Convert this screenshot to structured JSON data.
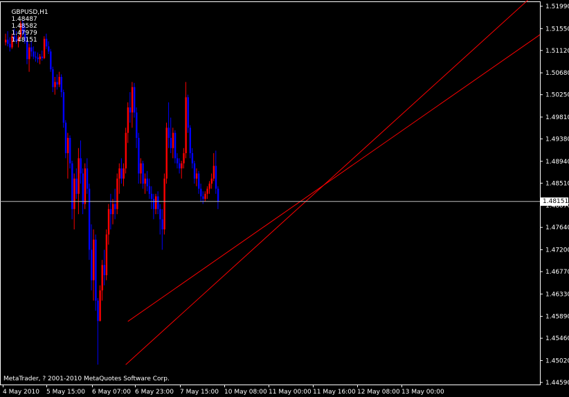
{
  "header": {
    "symbol": "GBPUSD,H1",
    "open": "1.48487",
    "high": "1.48582",
    "low": "1.47979",
    "close": "1.48151"
  },
  "copyright": "MetaTrader, ? 2001-2010 MetaQuotes Software Corp.",
  "current_price_label": "1.48151",
  "colors": {
    "background": "#000000",
    "bull": "#ff0000",
    "bear": "#0000ff",
    "text": "#ffffff",
    "axis": "#ffffff",
    "trendline": "#ff0000",
    "price_line": "#c0c0c0"
  },
  "chart_data": {
    "type": "candlestick",
    "y_ticks": [
      "1.51990",
      "1.51550",
      "1.51120",
      "1.50680",
      "1.50250",
      "1.49810",
      "1.49380",
      "1.48940",
      "1.48510",
      "1.48070",
      "1.47640",
      "1.47200",
      "1.46770",
      "1.46330",
      "1.45890",
      "1.45460",
      "1.45020",
      "1.44590"
    ],
    "y_tick_values": [
      1.5199,
      1.5155,
      1.5112,
      1.5068,
      1.5025,
      1.4981,
      1.4938,
      1.4894,
      1.4851,
      1.4807,
      1.4764,
      1.472,
      1.4677,
      1.4633,
      1.4589,
      1.4546,
      1.4502,
      1.4459
    ],
    "x_ticks": [
      "4 May 2010",
      "5 May 15:00",
      "6 May 07:00",
      "6 May 23:00",
      "7 May 15:00",
      "10 May 08:00",
      "11 May 00:00",
      "11 May 16:00",
      "12 May 08:00",
      "13 May 00:00"
    ],
    "current_price": 1.48151,
    "trendlines": [
      {
        "from": [
          57,
          1.4579
        ],
        "to": [
          200,
          1.4999
        ]
      },
      {
        "from": [
          56,
          1.4494
        ],
        "to": [
          200,
          1.5045
        ]
      }
    ],
    "candles": [
      [
        1.5128,
        1.5145,
        1.5122,
        1.5133
      ],
      [
        1.5133,
        1.515,
        1.512,
        1.5125
      ],
      [
        1.5125,
        1.5138,
        1.511,
        1.5118
      ],
      [
        1.5118,
        1.5145,
        1.5115,
        1.514
      ],
      [
        1.514,
        1.5155,
        1.513,
        1.5135
      ],
      [
        1.5135,
        1.515,
        1.5125,
        1.513
      ],
      [
        1.513,
        1.5142,
        1.5118,
        1.5138
      ],
      [
        1.5138,
        1.517,
        1.5135,
        1.5165
      ],
      [
        1.5165,
        1.5172,
        1.514,
        1.5145
      ],
      [
        1.5145,
        1.516,
        1.5125,
        1.513
      ],
      [
        1.513,
        1.514,
        1.5085,
        1.5095
      ],
      [
        1.5095,
        1.5125,
        1.507,
        1.5118
      ],
      [
        1.5118,
        1.513,
        1.51,
        1.511
      ],
      [
        1.511,
        1.512,
        1.5095,
        1.51
      ],
      [
        1.51,
        1.511,
        1.509,
        1.5098
      ],
      [
        1.5098,
        1.5108,
        1.5088,
        1.5095
      ],
      [
        1.5095,
        1.5105,
        1.5085,
        1.51
      ],
      [
        1.51,
        1.5112,
        1.5092,
        1.5097
      ],
      [
        1.5097,
        1.514,
        1.5095,
        1.5135
      ],
      [
        1.5135,
        1.5145,
        1.5115,
        1.512
      ],
      [
        1.512,
        1.513,
        1.5105,
        1.511
      ],
      [
        1.511,
        1.5115,
        1.507,
        1.5075
      ],
      [
        1.5075,
        1.508,
        1.503,
        1.504
      ],
      [
        1.504,
        1.506,
        1.5025,
        1.505
      ],
      [
        1.505,
        1.5065,
        1.5035,
        1.5045
      ],
      [
        1.5045,
        1.507,
        1.504,
        1.506
      ],
      [
        1.506,
        1.5065,
        1.502,
        1.503
      ],
      [
        1.503,
        1.5035,
        1.496,
        1.497
      ],
      [
        1.497,
        1.4975,
        1.49,
        1.491
      ],
      [
        1.491,
        1.495,
        1.486,
        1.494
      ],
      [
        1.494,
        1.4945,
        1.488,
        1.489
      ],
      [
        1.489,
        1.4895,
        1.478,
        1.48
      ],
      [
        1.48,
        1.487,
        1.476,
        1.486
      ],
      [
        1.486,
        1.488,
        1.482,
        1.483
      ],
      [
        1.483,
        1.492,
        1.479,
        1.49
      ],
      [
        1.49,
        1.4935,
        1.485,
        1.487
      ],
      [
        1.487,
        1.488,
        1.479,
        1.481
      ],
      [
        1.481,
        1.489,
        1.48,
        1.488
      ],
      [
        1.488,
        1.49,
        1.483,
        1.484
      ],
      [
        1.484,
        1.485,
        1.47,
        1.472
      ],
      [
        1.472,
        1.477,
        1.464,
        1.466
      ],
      [
        1.466,
        1.476,
        1.462,
        1.474
      ],
      [
        1.474,
        1.475,
        1.46,
        1.462
      ],
      [
        1.462,
        1.4625,
        1.4494,
        1.458
      ],
      [
        1.458,
        1.465,
        1.4579,
        1.464
      ],
      [
        1.464,
        1.47,
        1.462,
        1.469
      ],
      [
        1.469,
        1.472,
        1.465,
        1.467
      ],
      [
        1.467,
        1.476,
        1.466,
        1.475
      ],
      [
        1.475,
        1.481,
        1.473,
        1.48
      ],
      [
        1.48,
        1.483,
        1.476,
        1.479
      ],
      [
        1.479,
        1.482,
        1.477,
        1.481
      ],
      [
        1.481,
        1.484,
        1.478,
        1.48
      ],
      [
        1.48,
        1.487,
        1.479,
        1.486
      ],
      [
        1.486,
        1.489,
        1.483,
        1.488
      ],
      [
        1.488,
        1.49,
        1.485,
        1.486
      ],
      [
        1.486,
        1.489,
        1.4845,
        1.488
      ],
      [
        1.488,
        1.496,
        1.487,
        1.495
      ],
      [
        1.495,
        1.501,
        1.493,
        1.5
      ],
      [
        1.5,
        1.503,
        1.497,
        1.499
      ],
      [
        1.499,
        1.505,
        1.496,
        1.504
      ],
      [
        1.504,
        1.5048,
        1.498,
        1.499
      ],
      [
        1.499,
        1.5,
        1.492,
        1.494
      ],
      [
        1.494,
        1.495,
        1.485,
        1.487
      ],
      [
        1.487,
        1.49,
        1.485,
        1.489
      ],
      [
        1.489,
        1.4895,
        1.484,
        1.485
      ],
      [
        1.485,
        1.487,
        1.483,
        1.486
      ],
      [
        1.486,
        1.4875,
        1.4835,
        1.4845
      ],
      [
        1.4845,
        1.486,
        1.482,
        1.483
      ],
      [
        1.483,
        1.4845,
        1.48,
        1.482
      ],
      [
        1.482,
        1.483,
        1.478,
        1.48
      ],
      [
        1.48,
        1.483,
        1.479,
        1.4825
      ],
      [
        1.4825,
        1.4835,
        1.479,
        1.48
      ],
      [
        1.48,
        1.481,
        1.475,
        1.478
      ],
      [
        1.478,
        1.48,
        1.472,
        1.476
      ],
      [
        1.476,
        1.487,
        1.475,
        1.486
      ],
      [
        1.486,
        1.497,
        1.485,
        1.496
      ],
      [
        1.496,
        1.501,
        1.492,
        1.494
      ],
      [
        1.494,
        1.498,
        1.491,
        1.492
      ],
      [
        1.492,
        1.496,
        1.49,
        1.495
      ],
      [
        1.495,
        1.4955,
        1.489,
        1.49
      ],
      [
        1.49,
        1.491,
        1.488,
        1.489
      ],
      [
        1.489,
        1.49,
        1.487,
        1.488
      ],
      [
        1.488,
        1.4895,
        1.486,
        1.489
      ],
      [
        1.489,
        1.492,
        1.488,
        1.491
      ],
      [
        1.491,
        1.505,
        1.49,
        1.502
      ],
      [
        1.502,
        1.5025,
        1.495,
        1.496
      ],
      [
        1.496,
        1.4965,
        1.49,
        1.491
      ],
      [
        1.491,
        1.492,
        1.488,
        1.489
      ],
      [
        1.489,
        1.4895,
        1.485,
        1.486
      ],
      [
        1.486,
        1.488,
        1.4845,
        1.487
      ],
      [
        1.487,
        1.4875,
        1.483,
        1.484
      ],
      [
        1.484,
        1.485,
        1.4815,
        1.4825
      ],
      [
        1.4825,
        1.4835,
        1.481,
        1.482
      ],
      [
        1.482,
        1.4835,
        1.4815,
        1.483
      ],
      [
        1.483,
        1.4845,
        1.482,
        1.484
      ],
      [
        1.484,
        1.4855,
        1.483,
        1.485
      ],
      [
        1.485,
        1.487,
        1.484,
        1.486
      ],
      [
        1.486,
        1.491,
        1.4855,
        1.4885
      ],
      [
        1.4885,
        1.4915,
        1.483,
        1.484
      ],
      [
        1.484,
        1.4845,
        1.48,
        1.4815
      ]
    ]
  }
}
